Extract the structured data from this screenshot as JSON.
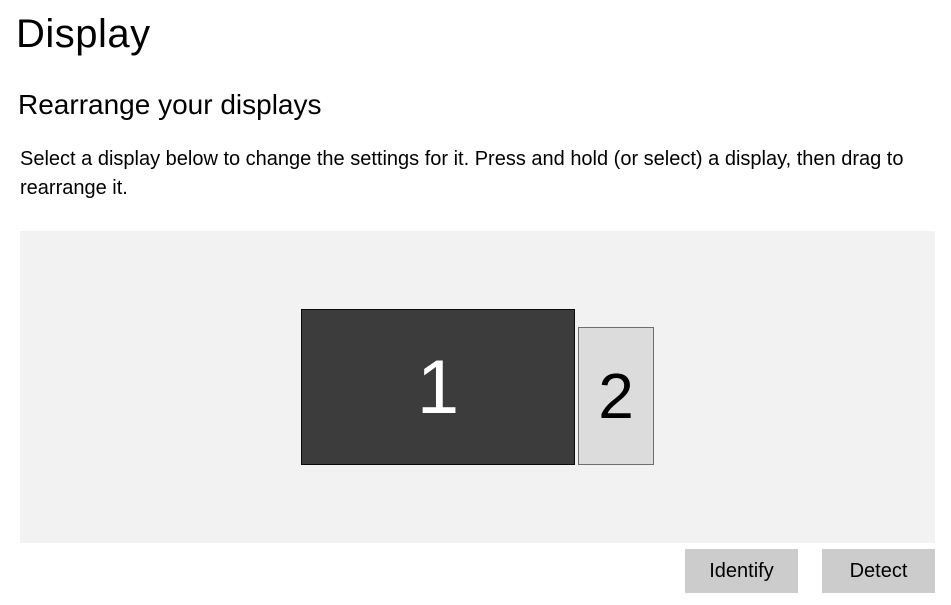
{
  "page": {
    "title": "Display"
  },
  "section": {
    "title": "Rearrange your displays",
    "description": "Select a display below to change the settings for it. Press and hold (or select) a display, then drag to rearrange it."
  },
  "monitors": [
    {
      "label": "1",
      "selected": true
    },
    {
      "label": "2",
      "selected": false
    }
  ],
  "buttons": {
    "identify": "Identify",
    "detect": "Detect"
  }
}
